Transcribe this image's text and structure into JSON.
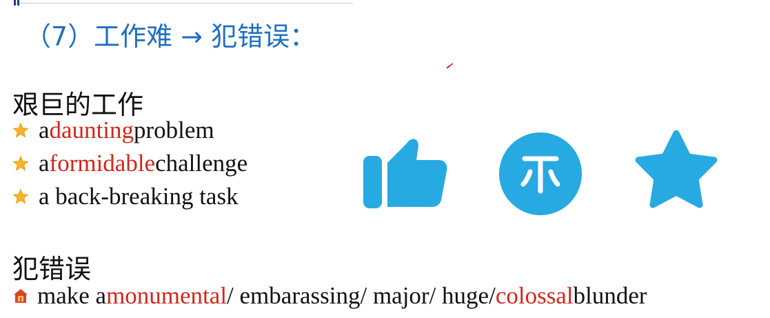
{
  "heading": "（7）工作难 → 犯错误：",
  "section1": {
    "title": "艰巨的工作",
    "items": [
      {
        "pre": "a ",
        "highlight": "daunting",
        "post": " problem"
      },
      {
        "pre": "a ",
        "highlight": "formidable",
        "post": " challenge"
      },
      {
        "pre": "a back-breaking task",
        "highlight": "",
        "post": ""
      }
    ]
  },
  "section2": {
    "title": "犯错误",
    "item": {
      "pre": "make a ",
      "highlight1": "monumental",
      "mid": "/ embarassing/ major/ huge/ ",
      "highlight2": "colossal",
      "post": " blunder"
    }
  },
  "icons": [
    "thumbs-up-icon",
    "coin-icon",
    "star-icon"
  ],
  "colors": {
    "heading": "#1f6fbf",
    "highlight": "#d0271d",
    "action_icon": "#27aae1",
    "star_bullet": "#f7b32b"
  }
}
